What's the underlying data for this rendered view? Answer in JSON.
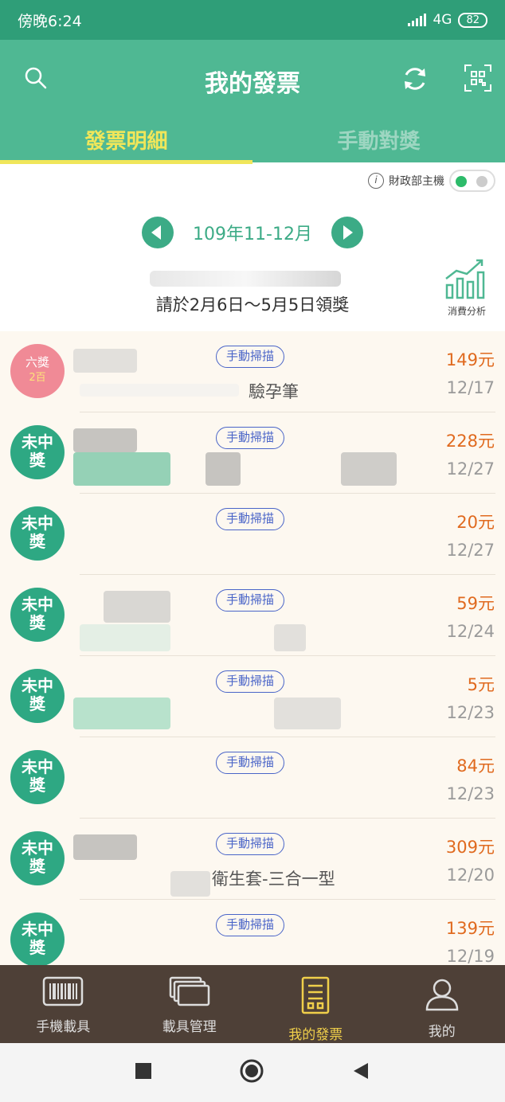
{
  "status_bar": {
    "time": "傍晚6:24",
    "network": "4G",
    "battery": "82"
  },
  "header": {
    "title": "我的發票"
  },
  "tabs": [
    {
      "label": "發票明細"
    },
    {
      "label": "手動對獎"
    }
  ],
  "mof_toggle": {
    "label": "財政部主機",
    "info": "i"
  },
  "period": {
    "label": "109年11-12月"
  },
  "claim_notice": "請於2月6日～5月5日領獎",
  "analysis": {
    "label": "消費分析"
  },
  "invoices": [
    {
      "badge": "六獎",
      "badge_sub": "2百",
      "tag": "手動掃描",
      "amount": "149元",
      "date": "12/17",
      "item": "驗孕筆"
    },
    {
      "badge": "未中獎",
      "tag": "手動掃描",
      "amount": "228元",
      "date": "12/27",
      "item": ""
    },
    {
      "badge": "未中獎",
      "tag": "手動掃描",
      "amount": "20元",
      "date": "12/27",
      "item": ""
    },
    {
      "badge": "未中獎",
      "tag": "手動掃描",
      "amount": "59元",
      "date": "12/24",
      "item": ""
    },
    {
      "badge": "未中獎",
      "tag": "手動掃描",
      "amount": "5元",
      "date": "12/23",
      "item": ""
    },
    {
      "badge": "未中獎",
      "tag": "手動掃描",
      "amount": "84元",
      "date": "12/23",
      "item": ""
    },
    {
      "badge": "未中獎",
      "tag": "手動掃描",
      "amount": "309元",
      "date": "12/20",
      "item": "衛生套-三合一型"
    },
    {
      "badge": "未中獎",
      "tag": "手動掃描",
      "amount": "139元",
      "date": "12/19",
      "item": ""
    }
  ],
  "bottom_nav": [
    {
      "label": "手機載具"
    },
    {
      "label": "載具管理"
    },
    {
      "label": "我的發票"
    },
    {
      "label": "我的"
    }
  ],
  "colors": {
    "primary": "#4fb893",
    "status": "#2f9e78",
    "accent_yellow": "#f0e65a",
    "amount": "#e06a1f",
    "nav_bg": "#4e4037"
  }
}
